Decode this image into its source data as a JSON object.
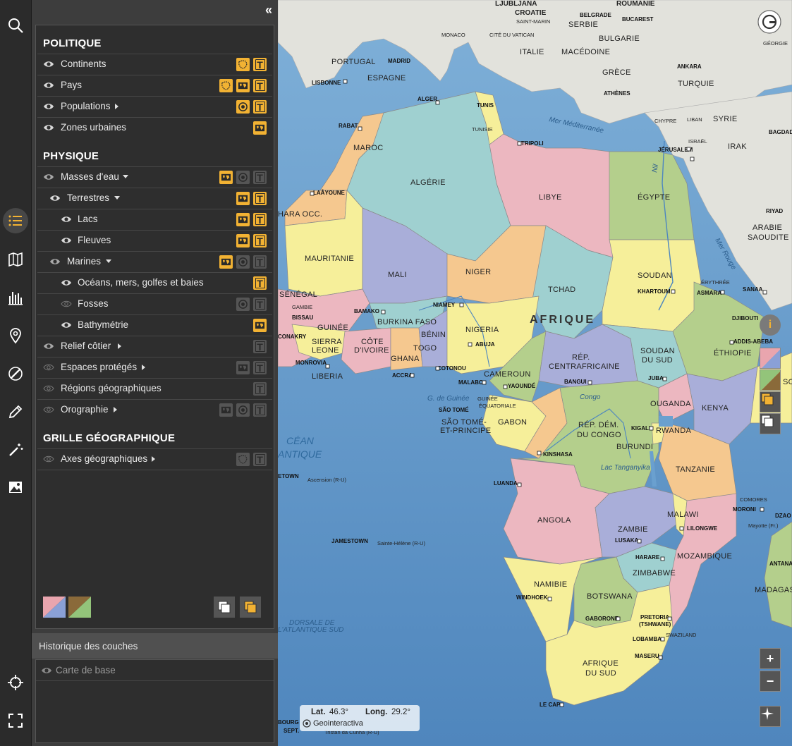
{
  "panel": {
    "sections": {
      "politique": "POLITIQUE",
      "physique": "PHYSIQUE",
      "grille": "GRILLE GÉOGRAPHIQUE"
    },
    "layers": {
      "continents": "Continents",
      "pays": "Pays",
      "populations": "Populations",
      "zones_urbaines": "Zones urbaines",
      "masses_eau": "Masses d'eau",
      "terrestres": "Terrestres",
      "lacs": "Lacs",
      "fleuves": "Fleuves",
      "marines": "Marines",
      "oceans": "Océans, mers, golfes et baies",
      "fosses": "Fosses",
      "bathymetrie": "Bathymétrie",
      "relief_cotier": "Relief côtier",
      "espaces_proteges": "Espaces protégés",
      "regions_geo": "Régions géographiques",
      "orographie": "Orographie",
      "axes_geo": "Axes géographiques"
    },
    "history_title": "Historique des couches",
    "history_item": "Carte de base"
  },
  "map": {
    "labels": {
      "ljubljana": "LJUBLJANA",
      "croatie": "CROATIE",
      "roumanie": "ROUMANIE",
      "belgrade": "BELGRADE",
      "bucarest": "BUCAREST",
      "saint_marin": "SAINT-MARIN",
      "serbie": "SERBIE",
      "monaco": "MONACO",
      "cite_vatican": "CITÉ DU VATICAN",
      "bulgarie": "BULGARIE",
      "italie": "ITALIE",
      "macedoine": "MACÉDOINE",
      "georgie": "GÉORGIE",
      "portugal": "PORTUGAL",
      "madrid": "MADRID",
      "espagne": "ESPAGNE",
      "ankara": "ANKARA",
      "turquie": "TURQUIE",
      "lisbonne": "LISBONNE",
      "grece": "GRÈCE",
      "athenes": "ATHÈNES",
      "alger": "ALGER",
      "tunis": "TUNIS",
      "mer_med": "Mer Méditerranée",
      "chypre": "CHYPRE",
      "liban": "LIBAN",
      "syrie": "SYRIE",
      "bagdad": "BAGDAD",
      "rabat": "RABAT",
      "tunisie": "TUNISIE",
      "tripoli": "TRIPOLI",
      "jerusalem": "JÉRUSALEM",
      "israel": "ISRAËL",
      "irak": "IRAK",
      "maroc": "MAROC",
      "algerie": "ALGÉRIE",
      "libye": "LIBYE",
      "egypte": "ÉGYPTE",
      "laayoune": "LAÂYOUNE",
      "nil": "Nil",
      "sahara_occ": "HARA OCC.",
      "riyad": "RIYAD",
      "arabie": "ARABIE",
      "saoudite": "SAOUDITE",
      "mer_rouge": "Mer Rouge",
      "mauritanie": "MAURITANIE",
      "mali": "MALI",
      "niger": "NIGER",
      "tchad": "TCHAD",
      "soudan": "SOUDAN",
      "khartoum": "KHARTOUM",
      "asmara": "ASMARA",
      "erythree": "ÉRYTHRÉE",
      "sanaa": "SANAA",
      "senegal": "SÉNÉGAL",
      "gambie": "GAMBIE",
      "bissau": "BISSAU",
      "niamey": "NIAMEY",
      "bamako": "BAMAKO",
      "burkina": "BURKINA FASO",
      "afrique": "AFRIQUE",
      "djibouti": "DJIBOUTI",
      "addis": "ADDIS-ABEBA",
      "ethiopie": "ÉTHIOPIE",
      "guinee": "GUINÉE",
      "conakry": "CONAKRY",
      "benin": "BÉNIN",
      "nigeria": "NIGERIA",
      "abuja": "ABUJA",
      "sierra": "SIERRA",
      "leone": "LEONE",
      "cote": "CÔTE",
      "divoire": "D'IVOIRE",
      "togo": "TOGO",
      "ghana": "GHANA",
      "monrovia": "MONROVIA",
      "liberia": "LIBERIA",
      "accra": "ACCRA",
      "cotonou": "COTONOU",
      "malabo": "MALABO",
      "cameroun": "CAMEROUN",
      "yaounde": "YAOUNDÉ",
      "rep": "RÉP.",
      "centrafricaine": "CENTRAFRICAINE",
      "bangui": "BANGUI",
      "soudan_sud1": "SOUDAN",
      "soudan_sud2": "DU SUD",
      "juba": "JUBA",
      "kenya": "KENYA",
      "ouganda": "OUGANDA",
      "g_guinee": "G. de Guinée",
      "sao_tome": "SÃO TOMÉ",
      "guinee_eq1": "GUINÉE",
      "guinee_eq2": "ÉQUATORIALE",
      "sao_tome_p1": "SÃO TOMÉ-",
      "sao_tome_p2": "ET-PRINCIPE",
      "gabon": "GABON",
      "congo_r": "Congo",
      "rdc1": "RÉP. DÉM.",
      "rdc2": "DU CONGO",
      "kigali": "KIGALI",
      "rwanda": "RWANDA",
      "burundi": "BURUNDI",
      "kinshasa": "KINSHASA",
      "ocean1": "CÉAN",
      "ocean2": "ANTIQUE",
      "lac_tang": "Lac Tanganyika",
      "tanzanie": "TANZANIE",
      "jamestown_g": "ETOWN",
      "ascension": "Ascension (R-U)",
      "luanda": "LUANDA",
      "angola": "ANGOLA",
      "comores": "COMORES",
      "moroni": "MORONI",
      "dzao": "DZAO",
      "mayotte": "Mayotte (Fr.)",
      "malawi": "MALAWI",
      "lilongwe": "LILONGWE",
      "zambie": "ZAMBIE",
      "lusaka": "LUSAKA",
      "jamestown": "JAMESTOWN",
      "sainte_helene": "Sainte-Hélène (R-U)",
      "harare": "HARARE",
      "mozambique": "MOZAMBIQUE",
      "zimbabwe": "ZIMBABWE",
      "antana": "ANTANA",
      "madagas": "MADAGAS",
      "namibie": "NAMIBIE",
      "windhoek": "WINDHOEK",
      "botswana": "BOTSWANA",
      "dorsale1": "DORSALE DE",
      "dorsale2": "L'ATLANTIQUE SUD",
      "gaborone": "GABORONE",
      "pretoria": "PRETORIA",
      "tshwane": "(TSHWANE)",
      "swaziland": "SWAZILAND",
      "lobamba": "LOBAMBA",
      "maseru": "MASERU",
      "afrique_sud1": "AFRIQUE",
      "afrique_sud2": "DU SUD",
      "le_cap": "LE CAP",
      "bourg": "BOURG",
      "sept": "SEPT.",
      "tristan": "Tristan da Cunha (R-U)",
      "sod": "SO"
    },
    "coords": {
      "lat_label": "Lat.",
      "lat_value": "46.3°",
      "long_label": "Long.",
      "long_value": "29.2°",
      "brand": "Geointeractiva"
    },
    "colors": {
      "ocean": "#5f95c7",
      "land_grey": "#e2e2dc",
      "pink": "#e9b3bd",
      "teal": "#9fd0d0",
      "yellow": "#f6ef9a",
      "orange": "#f5c88f",
      "purple": "#a9aed9",
      "green": "#b4cf8c",
      "accent": "#f2b233"
    }
  }
}
